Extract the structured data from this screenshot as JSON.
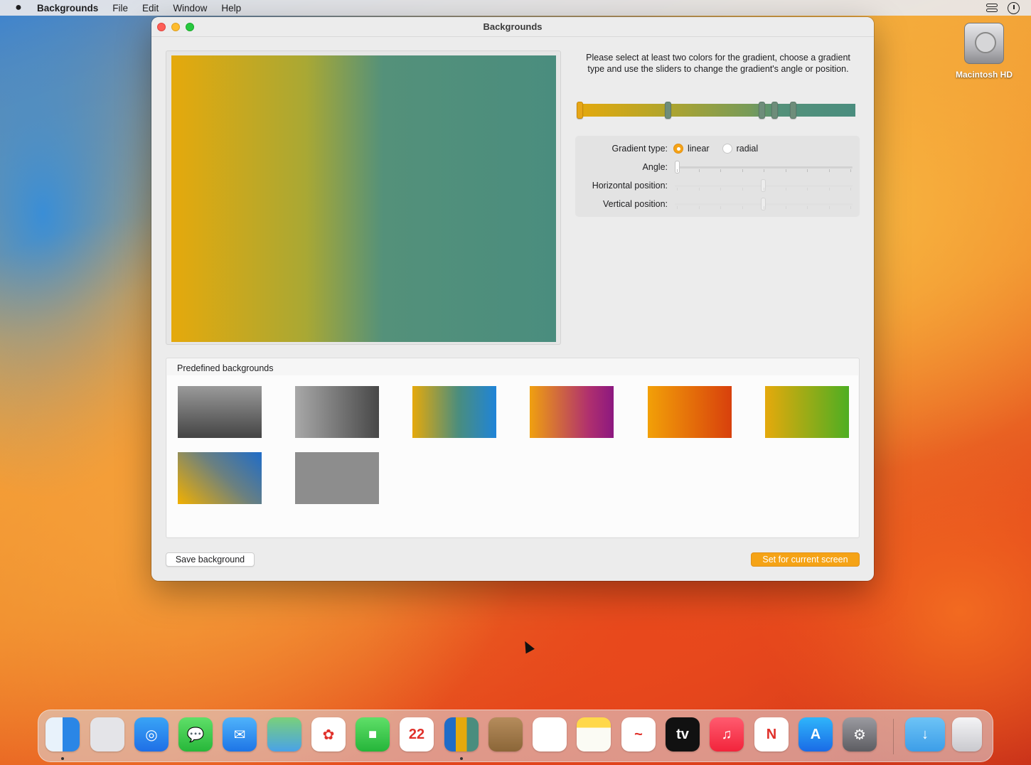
{
  "menubar": {
    "apple": "",
    "app_name": "Backgrounds",
    "items": [
      "File",
      "Edit",
      "Window",
      "Help"
    ]
  },
  "desktop": {
    "drive_label": "Macintosh HD"
  },
  "window": {
    "title": "Backgrounds",
    "instructions": "Please select at least two colors for the gradient, choose a gradient type and use the sliders to change the gradient's angle or position.",
    "gradient_colors": [
      "#e5a90c",
      "#54917a",
      "#4a8d7e"
    ],
    "controls": {
      "gradient_type_label": "Gradient type:",
      "linear_label": "linear",
      "radial_label": "radial",
      "selected_type": "linear",
      "angle_label": "Angle:",
      "horizontal_label": "Horizontal position:",
      "vertical_label": "Vertical position:"
    },
    "predefined": {
      "title": "Predefined backgrounds",
      "gradients": [
        "linear-gradient(180deg, #9a9a9a, #444)",
        "linear-gradient(90deg, #a8a8a8, #484848)",
        "linear-gradient(90deg, #e5a90c, #4a8d7e 55%, #1f84d8)",
        "linear-gradient(90deg, #f0a010, #b0306e 70%, #8c1880)",
        "linear-gradient(90deg, #f2a008, #d8400c)",
        "linear-gradient(90deg, #e5a90c, #4eae22)",
        "linear-gradient(45deg, #f2b000, #6b8080 55%, #1f6cc8)",
        "linear-gradient(180deg, #8d8d8d, #8d8d8d)"
      ]
    },
    "save_button": "Save background",
    "set_button": "Set for current screen"
  },
  "dock": {
    "apps": [
      {
        "name": "finder",
        "bg": "linear-gradient(90deg,#e8f2fb 50%,#2a86e6 50%)",
        "glyph": "",
        "dot": true
      },
      {
        "name": "launchpad",
        "bg": "#e4e4e8",
        "glyph": "",
        "dot": false
      },
      {
        "name": "safari",
        "bg": "linear-gradient(#39a4f6,#1f6fe6)",
        "glyph": "◎",
        "dot": false
      },
      {
        "name": "messages",
        "bg": "linear-gradient(#5fdf68,#27b73a)",
        "glyph": "💬",
        "dot": false
      },
      {
        "name": "mail",
        "bg": "linear-gradient(#4fb3fb,#1d75e6)",
        "glyph": "✉",
        "dot": false
      },
      {
        "name": "maps",
        "bg": "linear-gradient(#7ad07a,#4aa2e8)",
        "glyph": "",
        "dot": false
      },
      {
        "name": "photos",
        "bg": "#ffffff",
        "glyph": "✿",
        "dot": false
      },
      {
        "name": "facetime",
        "bg": "linear-gradient(#5fdf68,#25b53a)",
        "glyph": "■",
        "dot": false
      },
      {
        "name": "calendar",
        "bg": "#ffffff",
        "glyph": "22",
        "dot": false
      },
      {
        "name": "backgrounds",
        "bg": "linear-gradient(90deg,#1f6cc8 33%,#e5a90c 33%,#e5a90c 66%,#4a8d7e 66%)",
        "glyph": "",
        "dot": true
      },
      {
        "name": "contacts",
        "bg": "linear-gradient(#b58c5c,#8b6638)",
        "glyph": "",
        "dot": false
      },
      {
        "name": "reminders",
        "bg": "#ffffff",
        "glyph": "",
        "dot": false
      },
      {
        "name": "notes",
        "bg": "linear-gradient(#ffd84a 30%,#fbfbf4 30%)",
        "glyph": "",
        "dot": false
      },
      {
        "name": "freeform",
        "bg": "#ffffff",
        "glyph": "~",
        "dot": false
      },
      {
        "name": "tv",
        "bg": "#111111",
        "glyph": "tv",
        "dot": false
      },
      {
        "name": "music",
        "bg": "linear-gradient(#ff5b6f,#f2243b)",
        "glyph": "♫",
        "dot": false
      },
      {
        "name": "news",
        "bg": "#ffffff",
        "glyph": "N",
        "dot": false
      },
      {
        "name": "app-store",
        "bg": "linear-gradient(#2fb5fb,#1a6be6)",
        "glyph": "A",
        "dot": false
      },
      {
        "name": "system-settings",
        "bg": "linear-gradient(#9a9aa0,#5d5d62)",
        "glyph": "⚙",
        "dot": false
      }
    ],
    "downloads_glyph": "↓"
  }
}
